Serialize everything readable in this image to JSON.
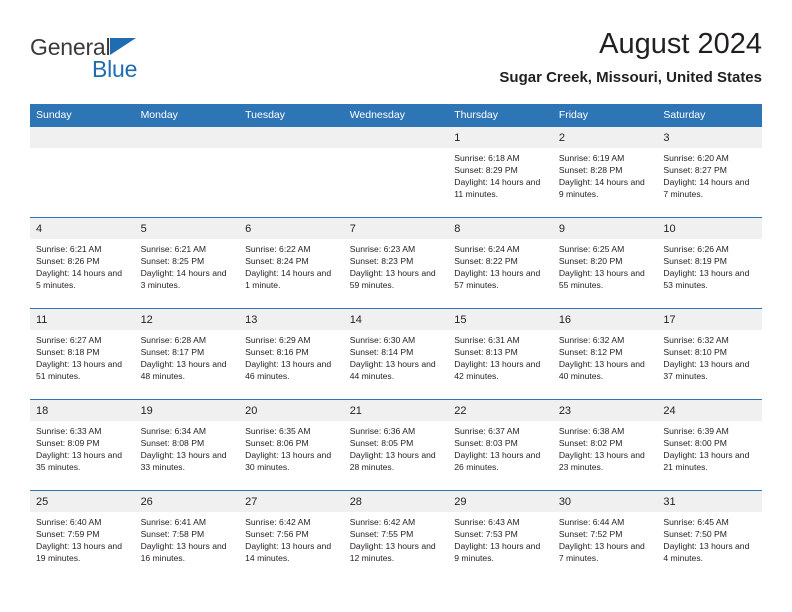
{
  "brand": {
    "name_part1": "General",
    "name_part2": "Blue",
    "flag_icon": "blue-triangle-flag-icon",
    "color_dark": "#3b3b3b",
    "color_blue": "#1f6cb0"
  },
  "header": {
    "month_title": "August 2024",
    "location": "Sugar Creek, Missouri, United States"
  },
  "theme": {
    "header_blue": "#2e75b6",
    "daynum_band": "#f0f0f0",
    "text": "#231f20"
  },
  "weekday_headers": [
    "Sunday",
    "Monday",
    "Tuesday",
    "Wednesday",
    "Thursday",
    "Friday",
    "Saturday"
  ],
  "weeks": [
    [
      {
        "day": "",
        "sunrise": "",
        "sunset": "",
        "daylight": ""
      },
      {
        "day": "",
        "sunrise": "",
        "sunset": "",
        "daylight": ""
      },
      {
        "day": "",
        "sunrise": "",
        "sunset": "",
        "daylight": ""
      },
      {
        "day": "",
        "sunrise": "",
        "sunset": "",
        "daylight": ""
      },
      {
        "day": "1",
        "sunrise": "Sunrise: 6:18 AM",
        "sunset": "Sunset: 8:29 PM",
        "daylight": "Daylight: 14 hours and 11 minutes."
      },
      {
        "day": "2",
        "sunrise": "Sunrise: 6:19 AM",
        "sunset": "Sunset: 8:28 PM",
        "daylight": "Daylight: 14 hours and 9 minutes."
      },
      {
        "day": "3",
        "sunrise": "Sunrise: 6:20 AM",
        "sunset": "Sunset: 8:27 PM",
        "daylight": "Daylight: 14 hours and 7 minutes."
      }
    ],
    [
      {
        "day": "4",
        "sunrise": "Sunrise: 6:21 AM",
        "sunset": "Sunset: 8:26 PM",
        "daylight": "Daylight: 14 hours and 5 minutes."
      },
      {
        "day": "5",
        "sunrise": "Sunrise: 6:21 AM",
        "sunset": "Sunset: 8:25 PM",
        "daylight": "Daylight: 14 hours and 3 minutes."
      },
      {
        "day": "6",
        "sunrise": "Sunrise: 6:22 AM",
        "sunset": "Sunset: 8:24 PM",
        "daylight": "Daylight: 14 hours and 1 minute."
      },
      {
        "day": "7",
        "sunrise": "Sunrise: 6:23 AM",
        "sunset": "Sunset: 8:23 PM",
        "daylight": "Daylight: 13 hours and 59 minutes."
      },
      {
        "day": "8",
        "sunrise": "Sunrise: 6:24 AM",
        "sunset": "Sunset: 8:22 PM",
        "daylight": "Daylight: 13 hours and 57 minutes."
      },
      {
        "day": "9",
        "sunrise": "Sunrise: 6:25 AM",
        "sunset": "Sunset: 8:20 PM",
        "daylight": "Daylight: 13 hours and 55 minutes."
      },
      {
        "day": "10",
        "sunrise": "Sunrise: 6:26 AM",
        "sunset": "Sunset: 8:19 PM",
        "daylight": "Daylight: 13 hours and 53 minutes."
      }
    ],
    [
      {
        "day": "11",
        "sunrise": "Sunrise: 6:27 AM",
        "sunset": "Sunset: 8:18 PM",
        "daylight": "Daylight: 13 hours and 51 minutes."
      },
      {
        "day": "12",
        "sunrise": "Sunrise: 6:28 AM",
        "sunset": "Sunset: 8:17 PM",
        "daylight": "Daylight: 13 hours and 48 minutes."
      },
      {
        "day": "13",
        "sunrise": "Sunrise: 6:29 AM",
        "sunset": "Sunset: 8:16 PM",
        "daylight": "Daylight: 13 hours and 46 minutes."
      },
      {
        "day": "14",
        "sunrise": "Sunrise: 6:30 AM",
        "sunset": "Sunset: 8:14 PM",
        "daylight": "Daylight: 13 hours and 44 minutes."
      },
      {
        "day": "15",
        "sunrise": "Sunrise: 6:31 AM",
        "sunset": "Sunset: 8:13 PM",
        "daylight": "Daylight: 13 hours and 42 minutes."
      },
      {
        "day": "16",
        "sunrise": "Sunrise: 6:32 AM",
        "sunset": "Sunset: 8:12 PM",
        "daylight": "Daylight: 13 hours and 40 minutes."
      },
      {
        "day": "17",
        "sunrise": "Sunrise: 6:32 AM",
        "sunset": "Sunset: 8:10 PM",
        "daylight": "Daylight: 13 hours and 37 minutes."
      }
    ],
    [
      {
        "day": "18",
        "sunrise": "Sunrise: 6:33 AM",
        "sunset": "Sunset: 8:09 PM",
        "daylight": "Daylight: 13 hours and 35 minutes."
      },
      {
        "day": "19",
        "sunrise": "Sunrise: 6:34 AM",
        "sunset": "Sunset: 8:08 PM",
        "daylight": "Daylight: 13 hours and 33 minutes."
      },
      {
        "day": "20",
        "sunrise": "Sunrise: 6:35 AM",
        "sunset": "Sunset: 8:06 PM",
        "daylight": "Daylight: 13 hours and 30 minutes."
      },
      {
        "day": "21",
        "sunrise": "Sunrise: 6:36 AM",
        "sunset": "Sunset: 8:05 PM",
        "daylight": "Daylight: 13 hours and 28 minutes."
      },
      {
        "day": "22",
        "sunrise": "Sunrise: 6:37 AM",
        "sunset": "Sunset: 8:03 PM",
        "daylight": "Daylight: 13 hours and 26 minutes."
      },
      {
        "day": "23",
        "sunrise": "Sunrise: 6:38 AM",
        "sunset": "Sunset: 8:02 PM",
        "daylight": "Daylight: 13 hours and 23 minutes."
      },
      {
        "day": "24",
        "sunrise": "Sunrise: 6:39 AM",
        "sunset": "Sunset: 8:00 PM",
        "daylight": "Daylight: 13 hours and 21 minutes."
      }
    ],
    [
      {
        "day": "25",
        "sunrise": "Sunrise: 6:40 AM",
        "sunset": "Sunset: 7:59 PM",
        "daylight": "Daylight: 13 hours and 19 minutes."
      },
      {
        "day": "26",
        "sunrise": "Sunrise: 6:41 AM",
        "sunset": "Sunset: 7:58 PM",
        "daylight": "Daylight: 13 hours and 16 minutes."
      },
      {
        "day": "27",
        "sunrise": "Sunrise: 6:42 AM",
        "sunset": "Sunset: 7:56 PM",
        "daylight": "Daylight: 13 hours and 14 minutes."
      },
      {
        "day": "28",
        "sunrise": "Sunrise: 6:42 AM",
        "sunset": "Sunset: 7:55 PM",
        "daylight": "Daylight: 13 hours and 12 minutes."
      },
      {
        "day": "29",
        "sunrise": "Sunrise: 6:43 AM",
        "sunset": "Sunset: 7:53 PM",
        "daylight": "Daylight: 13 hours and 9 minutes."
      },
      {
        "day": "30",
        "sunrise": "Sunrise: 6:44 AM",
        "sunset": "Sunset: 7:52 PM",
        "daylight": "Daylight: 13 hours and 7 minutes."
      },
      {
        "day": "31",
        "sunrise": "Sunrise: 6:45 AM",
        "sunset": "Sunset: 7:50 PM",
        "daylight": "Daylight: 13 hours and 4 minutes."
      }
    ]
  ]
}
